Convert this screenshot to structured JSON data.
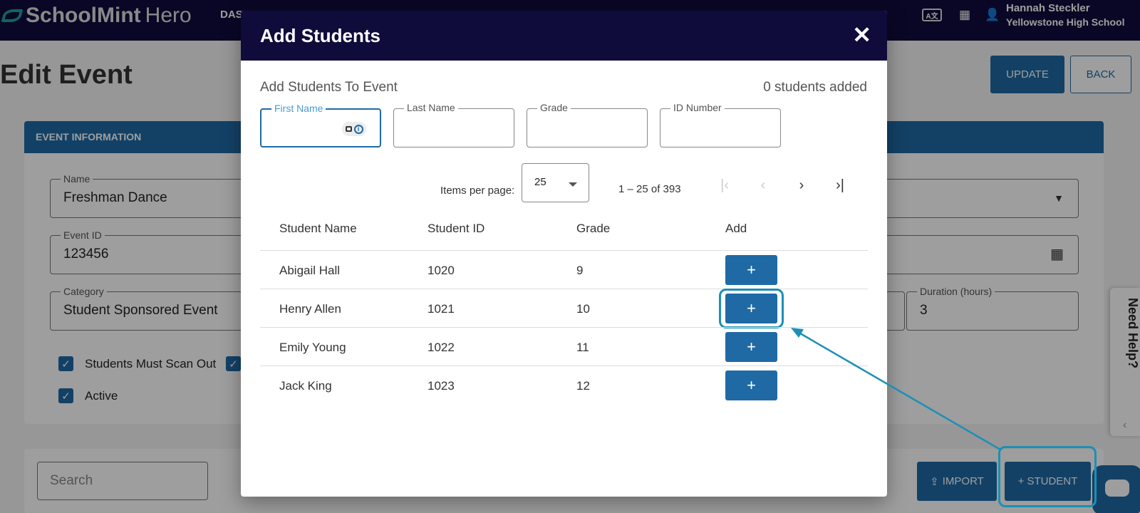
{
  "app": {
    "brand_bold": "SchoolMint",
    "brand_light": "Hero",
    "nav_item": "DAS",
    "user_name": "Hannah Steckler",
    "user_school": "Yellowstone High School"
  },
  "page": {
    "title": "Edit Event",
    "update_label": "UPDATE",
    "back_label": "BACK",
    "panel_title": "EVENT INFORMATION",
    "fields": {
      "name_label": "Name",
      "name_value": "Freshman Dance",
      "event_id_label": "Event ID",
      "event_id_value": "123456",
      "category_label": "Category",
      "category_value": "Student Sponsored Event",
      "duration_label": "Duration (hours)",
      "duration_value": "3"
    },
    "checkboxes": {
      "scan_out": "Students Must Scan Out",
      "active": "Active"
    },
    "search_placeholder": "Search",
    "import_label": "IMPORT",
    "student_label": "STUDENT",
    "help_label": "Need Help?"
  },
  "dialog": {
    "title": "Add Students",
    "subtitle": "Add Students To Event",
    "added_count": "0 students added",
    "filters": {
      "first_name": "First Name",
      "last_name": "Last Name",
      "grade": "Grade",
      "id_number": "ID Number"
    },
    "paginator": {
      "items_label": "Items per page:",
      "page_size": "25",
      "range": "1 – 25 of 393"
    },
    "columns": [
      "Student Name",
      "Student ID",
      "Grade",
      "Add"
    ],
    "rows": [
      {
        "name": "Abigail Hall",
        "id": "1020",
        "grade": "9"
      },
      {
        "name": "Henry Allen",
        "id": "1021",
        "grade": "10"
      },
      {
        "name": "Emily Young",
        "id": "1022",
        "grade": "11"
      },
      {
        "name": "Jack King",
        "id": "1023",
        "grade": "12"
      }
    ],
    "add_symbol": "+"
  },
  "colors": {
    "primary": "#1f6aa5",
    "header_navy": "#0f0c3c",
    "highlight": "#1c8fb5"
  }
}
